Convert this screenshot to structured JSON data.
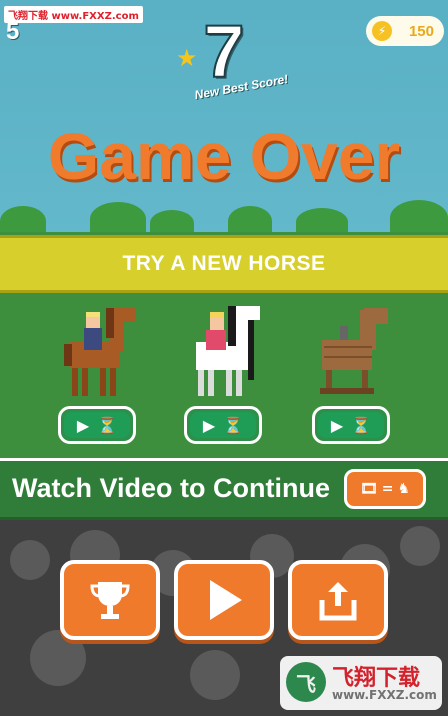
{
  "watermark": {
    "top": "飞翔下载 www.FXXZ.com",
    "bottom_name": "飞翔下载",
    "bottom_url": "www.FXXZ.com"
  },
  "hud": {
    "level": "5",
    "coins": "150"
  },
  "score": {
    "value": "7",
    "best_label": "New Best Score!"
  },
  "title": "Game Over",
  "try_banner": "TRY A NEW HORSE",
  "horses": [
    {
      "name": "brown-horse"
    },
    {
      "name": "white-horse"
    },
    {
      "name": "wooden-horse"
    }
  ],
  "watch": {
    "label": "Watch Video to Continue",
    "equals": "="
  },
  "buttons": [
    {
      "name": "leaderboard-button",
      "icon": "trophy-icon"
    },
    {
      "name": "play-button",
      "icon": "play-icon"
    },
    {
      "name": "share-button",
      "icon": "share-icon"
    }
  ],
  "colors": {
    "accent": "#f07a2b",
    "banner": "#d7cf2c",
    "field": "#3d8f3d",
    "sky": "#5bb1c6"
  }
}
